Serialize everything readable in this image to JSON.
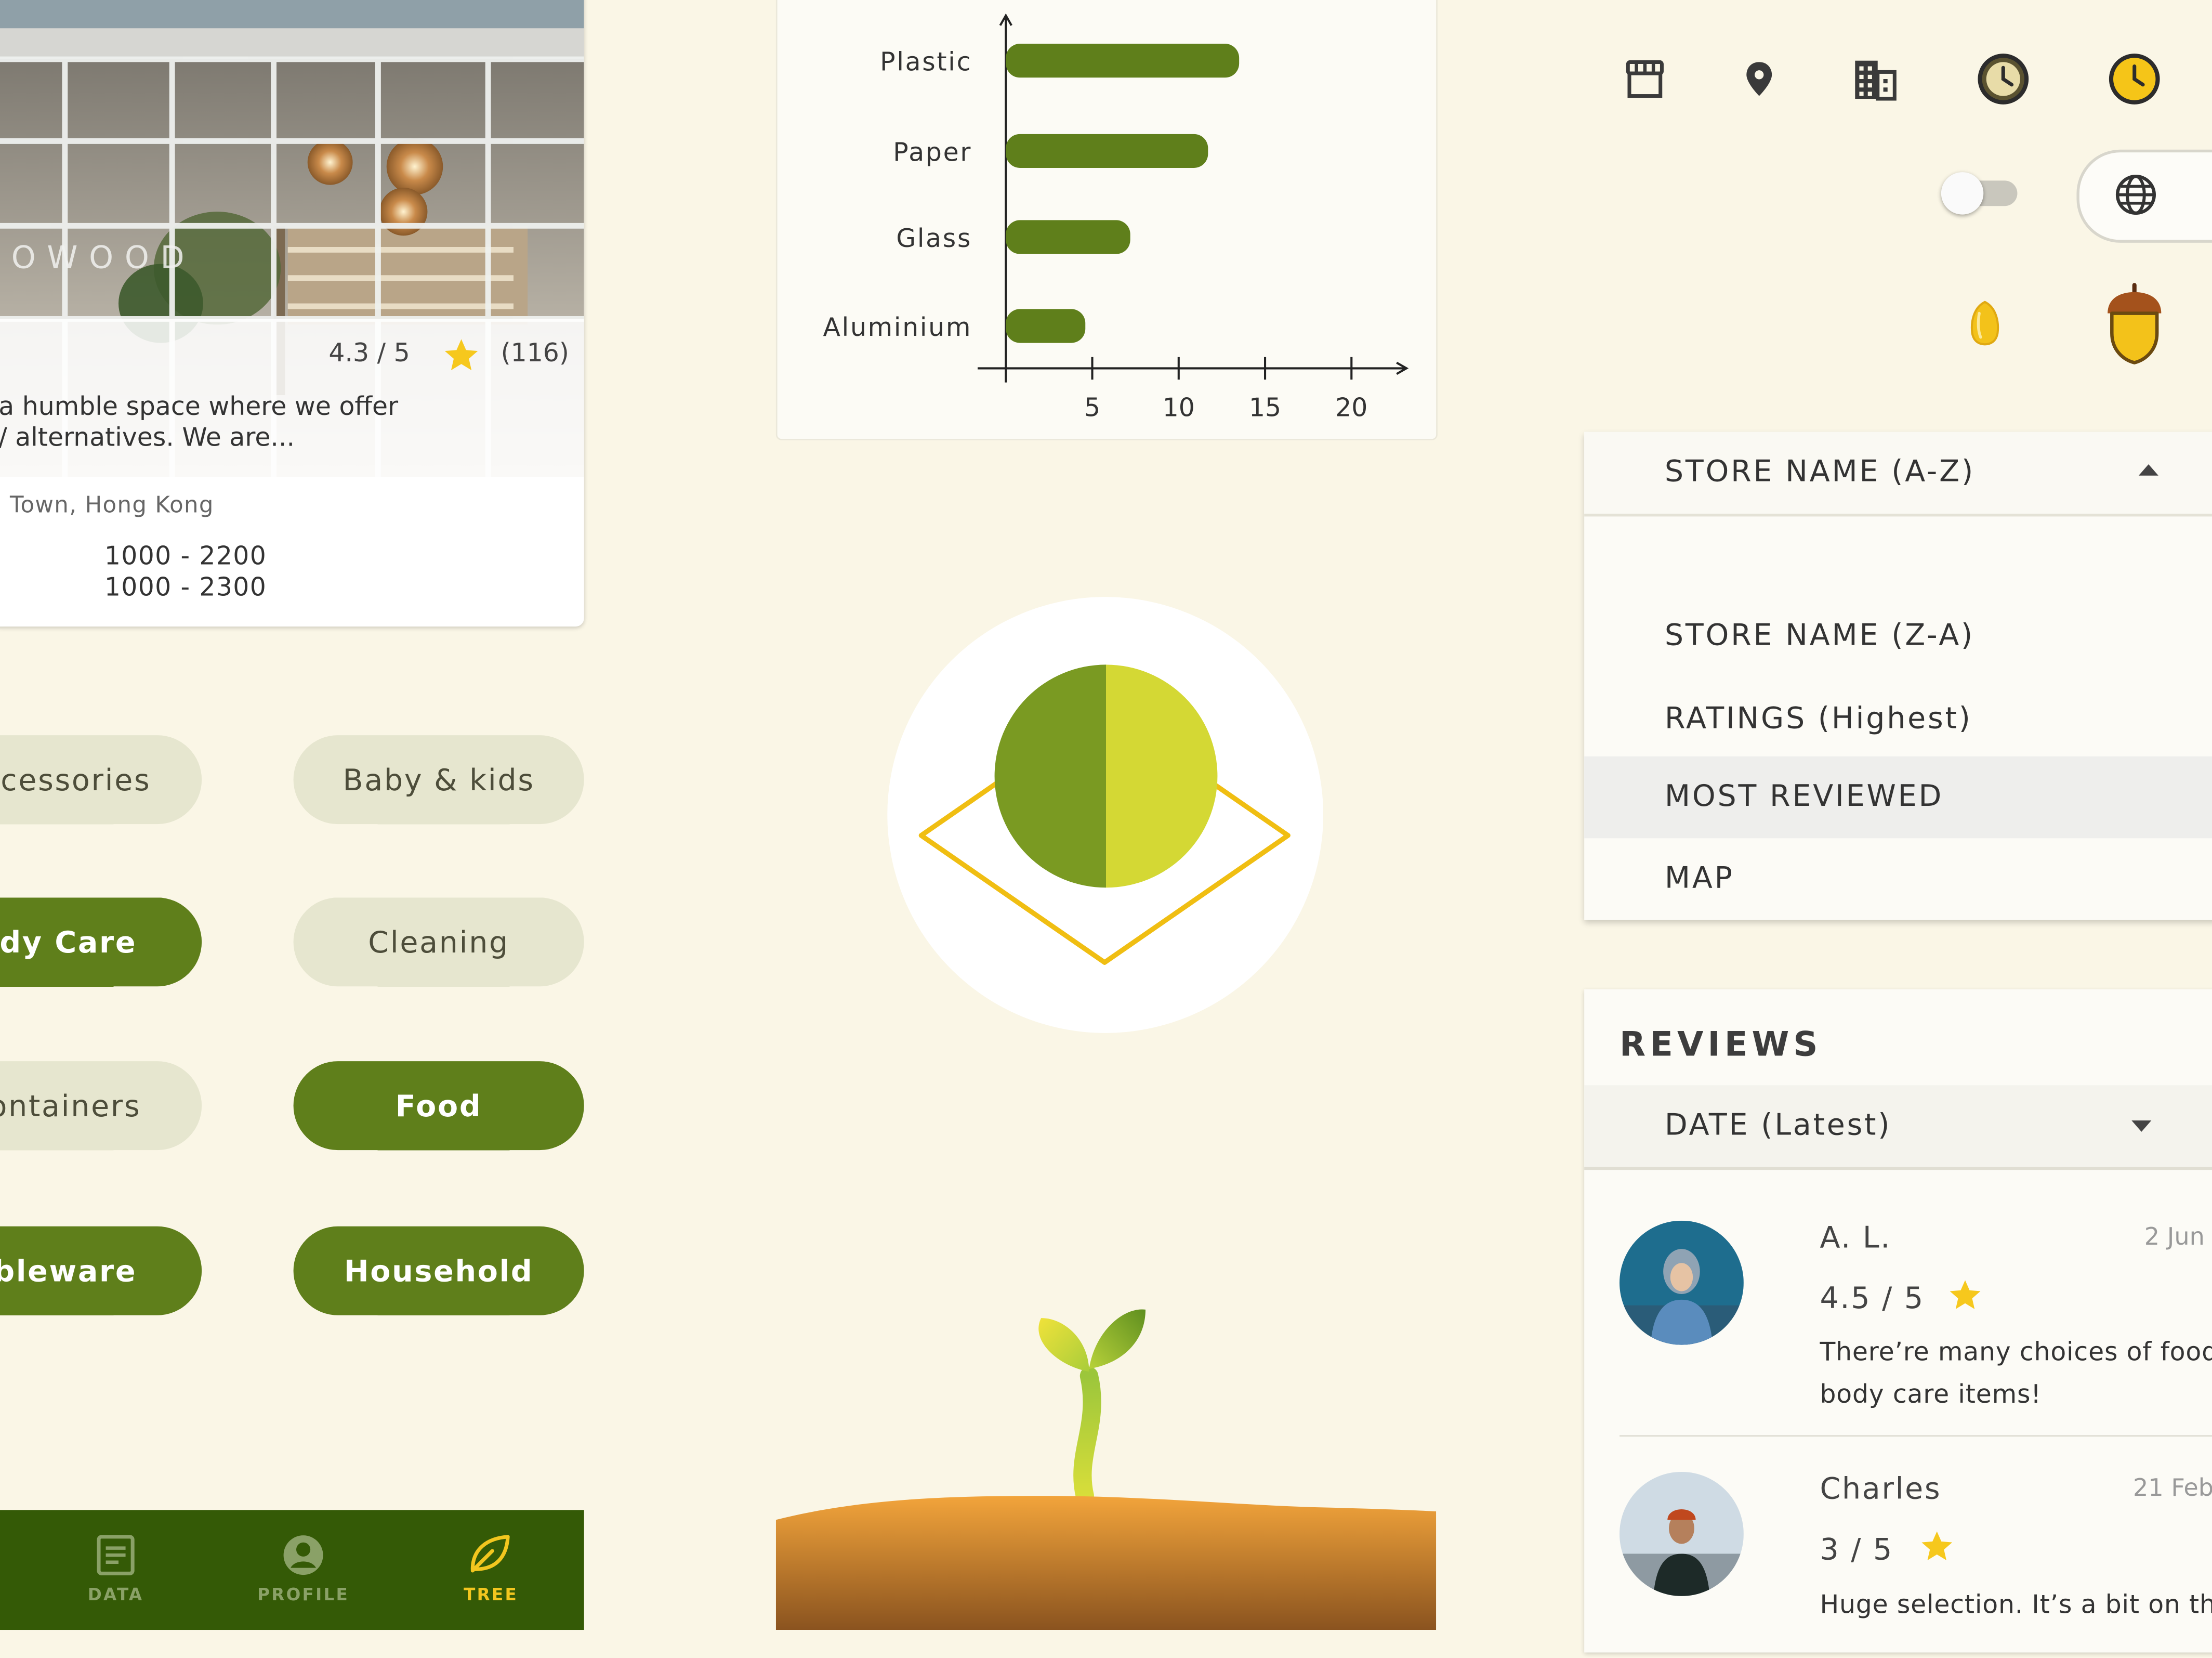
{
  "store_card": {
    "sign_text": "OWOOD",
    "rating": "4.3 / 5",
    "review_count": "(116)",
    "description_line1": "a humble space where we offer",
    "description_line2": "/ alternatives. We are...",
    "address": "Town, Hong Kong",
    "hours_line1": "1000 - 2200",
    "hours_line2": "1000 - 2300"
  },
  "categories": [
    {
      "label": "cessories",
      "active": false
    },
    {
      "label": "Baby & kids",
      "active": false
    },
    {
      "label": "ody Care",
      "active": true
    },
    {
      "label": "Cleaning",
      "active": false
    },
    {
      "label": "ontainers",
      "active": false
    },
    {
      "label": "Food",
      "active": true
    },
    {
      "label": "ableware",
      "active": true
    },
    {
      "label": "Household",
      "active": true
    }
  ],
  "bottom_nav": {
    "items": [
      {
        "label": "DATA",
        "icon": "document-icon",
        "active": false
      },
      {
        "label": "PROFILE",
        "icon": "account-circle-icon",
        "active": false
      },
      {
        "label": "TREE",
        "icon": "leaf-icon",
        "active": true
      }
    ],
    "colors": {
      "background": "#345a06",
      "inactive": "#8aa167",
      "active": "#f2c61f"
    }
  },
  "chart_data": {
    "type": "bar",
    "orientation": "horizontal",
    "categories": [
      "Plastic",
      "Paper",
      "Glass",
      "Aluminium"
    ],
    "values": [
      13.5,
      11.7,
      7.2,
      4.6
    ],
    "x_ticks": [
      "5",
      "10",
      "15",
      "20"
    ],
    "xlim": [
      0,
      23
    ],
    "title": "",
    "xlabel": "",
    "ylabel": "",
    "grid": false,
    "bar_color": "#5f7f1b"
  },
  "badge": {
    "colors": {
      "left": "#7a9a22",
      "right": "#d4d834",
      "diamond": "#f0be12"
    }
  },
  "header_icons": [
    "store-icon",
    "location-pin-icon",
    "building-icon",
    "clock-dark-icon",
    "clock-yellow-icon",
    "globe-icon",
    "seed-icon",
    "acorn-icon"
  ],
  "toggle": {
    "on": false
  },
  "sort": {
    "selected": "STORE NAME (A-Z)",
    "options": [
      "STORE NAME (Z-A)",
      "RATINGS (Highest)",
      "MOST REVIEWED",
      "MAP"
    ],
    "highlighted": "MOST REVIEWED"
  },
  "reviews": {
    "title": "REVIEWS",
    "sort_selected": "DATE (Latest)",
    "items": [
      {
        "name": "A. L.",
        "date": "2 Jun",
        "rating": "4.5 / 5",
        "text_line1": "There’re many choices of food",
        "text_line2": "body care items!"
      },
      {
        "name": "Charles",
        "date": "21 Feb",
        "rating": "3 / 5",
        "text_line1": "Huge selection. It’s a bit on th",
        "text_line2": ""
      }
    ]
  },
  "colors": {
    "background": "#faf6e6",
    "accent_green": "#5f7f1b",
    "pill_light": "#e6e6cf",
    "star": "#f6c81d"
  }
}
